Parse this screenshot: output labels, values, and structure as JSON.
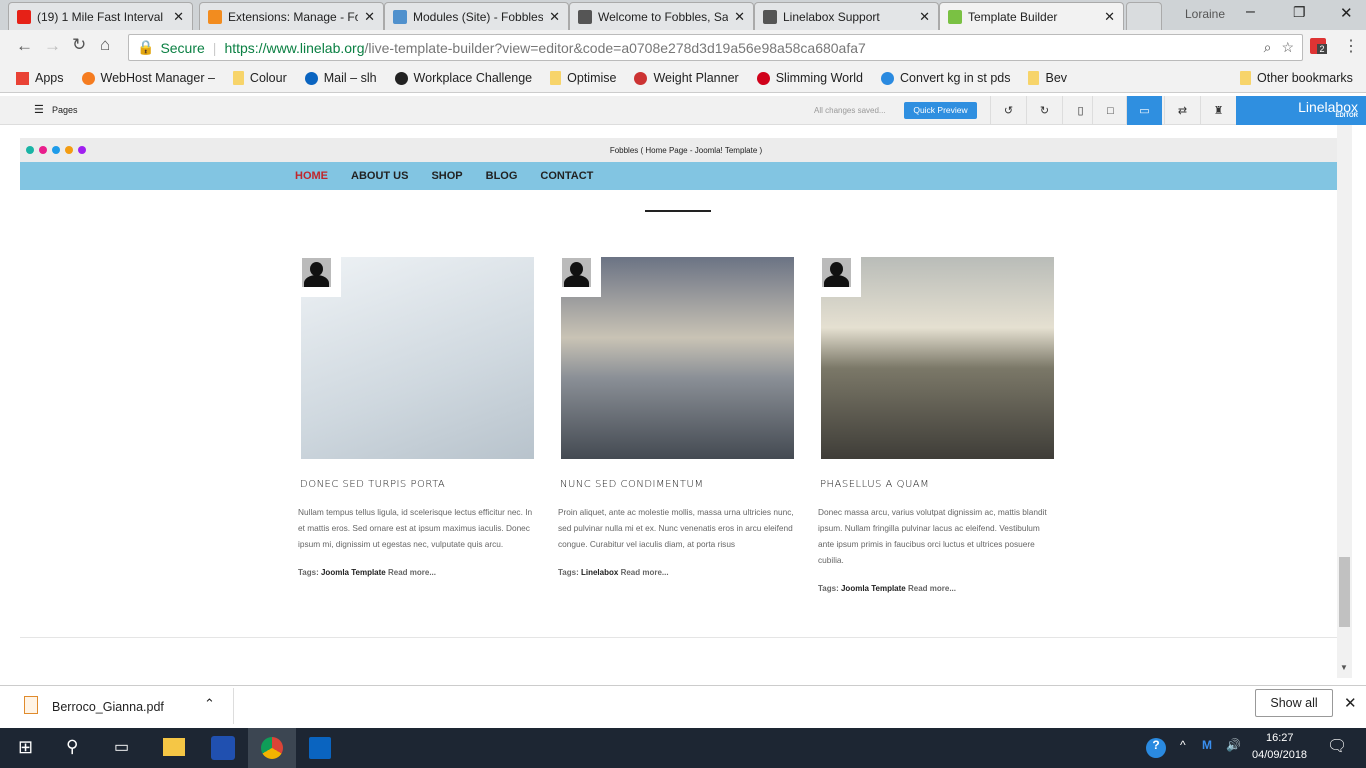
{
  "browser": {
    "tabs": [
      {
        "title": "(19) 1 Mile Fast Interval",
        "icon": "youtube-icon",
        "color": "#e62117"
      },
      {
        "title": "Extensions: Manage - Fo",
        "icon": "joomla-icon",
        "color": "#f28c1f"
      },
      {
        "title": "Modules (Site) - Fobbles",
        "icon": "joomla-icon",
        "color": "#5091cd"
      },
      {
        "title": "Welcome to Fobbles, Sa",
        "icon": "code-icon",
        "color": "#555"
      },
      {
        "title": "Linelabox Support",
        "icon": "code-icon",
        "color": "#555"
      },
      {
        "title": "Template Builder",
        "icon": "joomla-icon",
        "color": "#7ac143"
      }
    ],
    "profile": "Loraine",
    "secure_label": "Secure",
    "url_host": "https://www.linelab.org",
    "url_path": "/live-template-builder?view=editor&code=a0708e278d3d19a56e98a58ca680afa7",
    "ext_badge": "2",
    "bookmarks": [
      "Apps",
      "WebHost Manager –",
      "Colour",
      "Mail – slh",
      "Workplace Challenge",
      "Optimise",
      "Weight Planner",
      "Slimming World",
      "Convert kg in st pds",
      "Bev"
    ],
    "other_bookmarks": "Other bookmarks"
  },
  "editor": {
    "pages_label": "Pages",
    "status": "All changes saved...",
    "preview_label": "Quick Preview",
    "brand": "Linelabox",
    "brand_sub": "EDITOR",
    "accent": "#2f8fe0"
  },
  "site": {
    "window_title": "Fobbles ( Home Page - Joomla! Template )",
    "nav": [
      "HOME",
      "ABOUT US",
      "SHOP",
      "BLOG",
      "CONTACT"
    ],
    "nav_active_color": "#c0272d",
    "posts": [
      {
        "title": "DONEC SED TURPIS PORTA",
        "text": "Nullam tempus tellus ligula, id scelerisque lectus efficitur nec. In et mattis eros. Sed ornare est at ipsum maximus iaculis. Donec ipsum mi, dignissim ut egestas nec, vulputate quis arcu.",
        "tags_label": "Tags:",
        "tag": "Joomla Template",
        "read_more": "Read more..."
      },
      {
        "title": "NUNC SED CONDIMENTUM",
        "text": "Proin aliquet, ante ac molestie mollis, massa urna ultricies nunc, sed pulvinar nulla mi et ex. Nunc venenatis eros in arcu eleifend congue. Curabitur vel iaculis diam, at porta risus",
        "tags_label": "Tags:",
        "tag": "Linelabox",
        "read_more": "Read more..."
      },
      {
        "title": "PHASELLUS A QUAM",
        "text": "Donec massa arcu, varius volutpat dignissim ac, mattis blandit ipsum. Nullam fringilla pulvinar lacus ac eleifend. Vestibulum ante ipsum primis in faucibus orci luctus et ultrices posuere cubilia.",
        "tags_label": "Tags:",
        "tag": "Joomla Template",
        "read_more": "Read more..."
      }
    ]
  },
  "download": {
    "file": "Berroco_Gianna.pdf",
    "show_all": "Show all"
  },
  "taskbar": {
    "time": "16:27",
    "date": "04/09/2018"
  }
}
